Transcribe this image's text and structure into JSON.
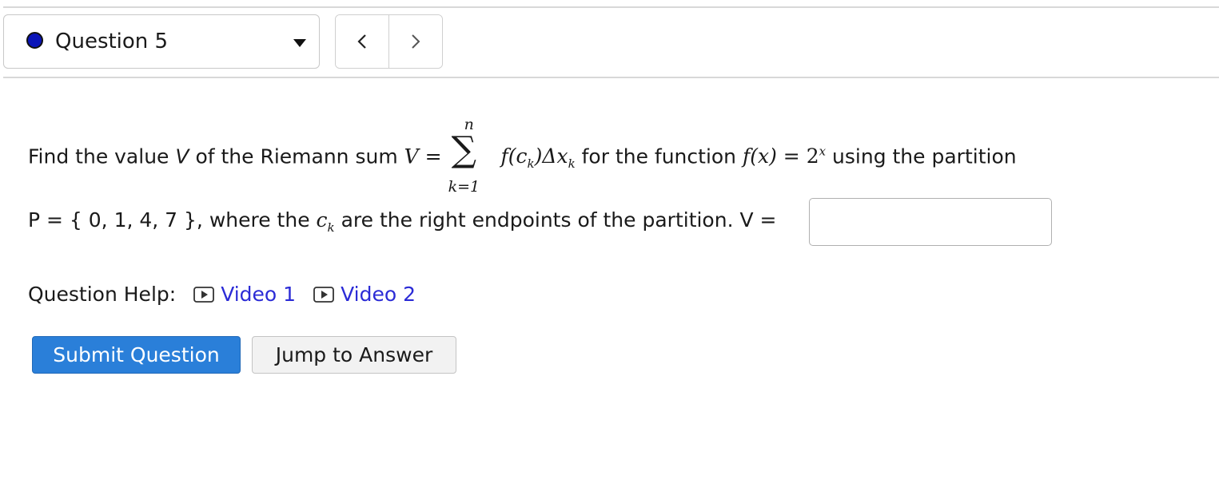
{
  "header": {
    "question_label": "Question 5",
    "status_color": "#0a14b8",
    "prev_icon": "chevron-left-icon",
    "next_icon": "chevron-right-icon"
  },
  "question": {
    "intro": "Find the value",
    "var_v": "V",
    "of_riemann": "of the Riemann sum",
    "sum_lhs": "V",
    "equals": "=",
    "sum_upper": "n",
    "sum_lower": "k=1",
    "summand": "f(c",
    "summand_sub": "k",
    "summand_mid": ")Δx",
    "summand_sub2": "k",
    "for_function": "for the function",
    "func_lhs": "f(x)",
    "func_base": "2",
    "func_exp": "x",
    "using_partition": "using the partition",
    "partition": "P = { 0, 1, 4, 7 }, where the",
    "ck": "c",
    "ck_sub": "k",
    "right_endpoints": "are the right endpoints of the partition.",
    "answer_label": "V =",
    "answer_value": ""
  },
  "help": {
    "label": "Question Help:",
    "video1": "Video 1",
    "video2": "Video 2"
  },
  "buttons": {
    "submit": "Submit Question",
    "jump": "Jump to Answer",
    "submit_color": "#2a7fd9"
  }
}
